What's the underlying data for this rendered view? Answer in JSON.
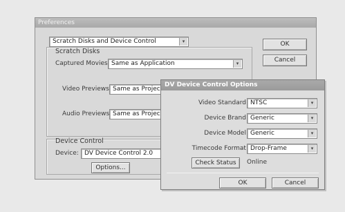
{
  "preferences": {
    "title": "Preferences",
    "section_select": "Scratch Disks and Device Control",
    "ok_label": "OK",
    "cancel_label": "Cancel",
    "scratch": {
      "title": "Scratch Disks",
      "captured_movies_label": "Captured Movies:",
      "captured_movies_value": "Same as Application",
      "video_previews_label": "Video Previews:",
      "video_previews_value": "Same as Project File",
      "audio_previews_label": "Audio Previews:",
      "audio_previews_value": "Same as Project File"
    },
    "device": {
      "title": "Device Control",
      "device_label": "Device:",
      "device_value": "DV Device Control 2.0",
      "options_label": "Options..."
    }
  },
  "dv_dialog": {
    "title": "DV Device Control Options",
    "video_standard_label": "Video Standard:",
    "video_standard_value": "NTSC",
    "device_brand_label": "Device Brand:",
    "device_brand_value": "Generic",
    "device_model_label": "Device Model:",
    "device_model_value": "Generic",
    "timecode_label": "Timecode Format:",
    "timecode_value": "Drop-Frame",
    "check_status_label": "Check Status",
    "status_value": "Online",
    "ok_label": "OK",
    "cancel_label": "Cancel"
  },
  "icons": {
    "dropdown": "chevron-down-icon"
  }
}
